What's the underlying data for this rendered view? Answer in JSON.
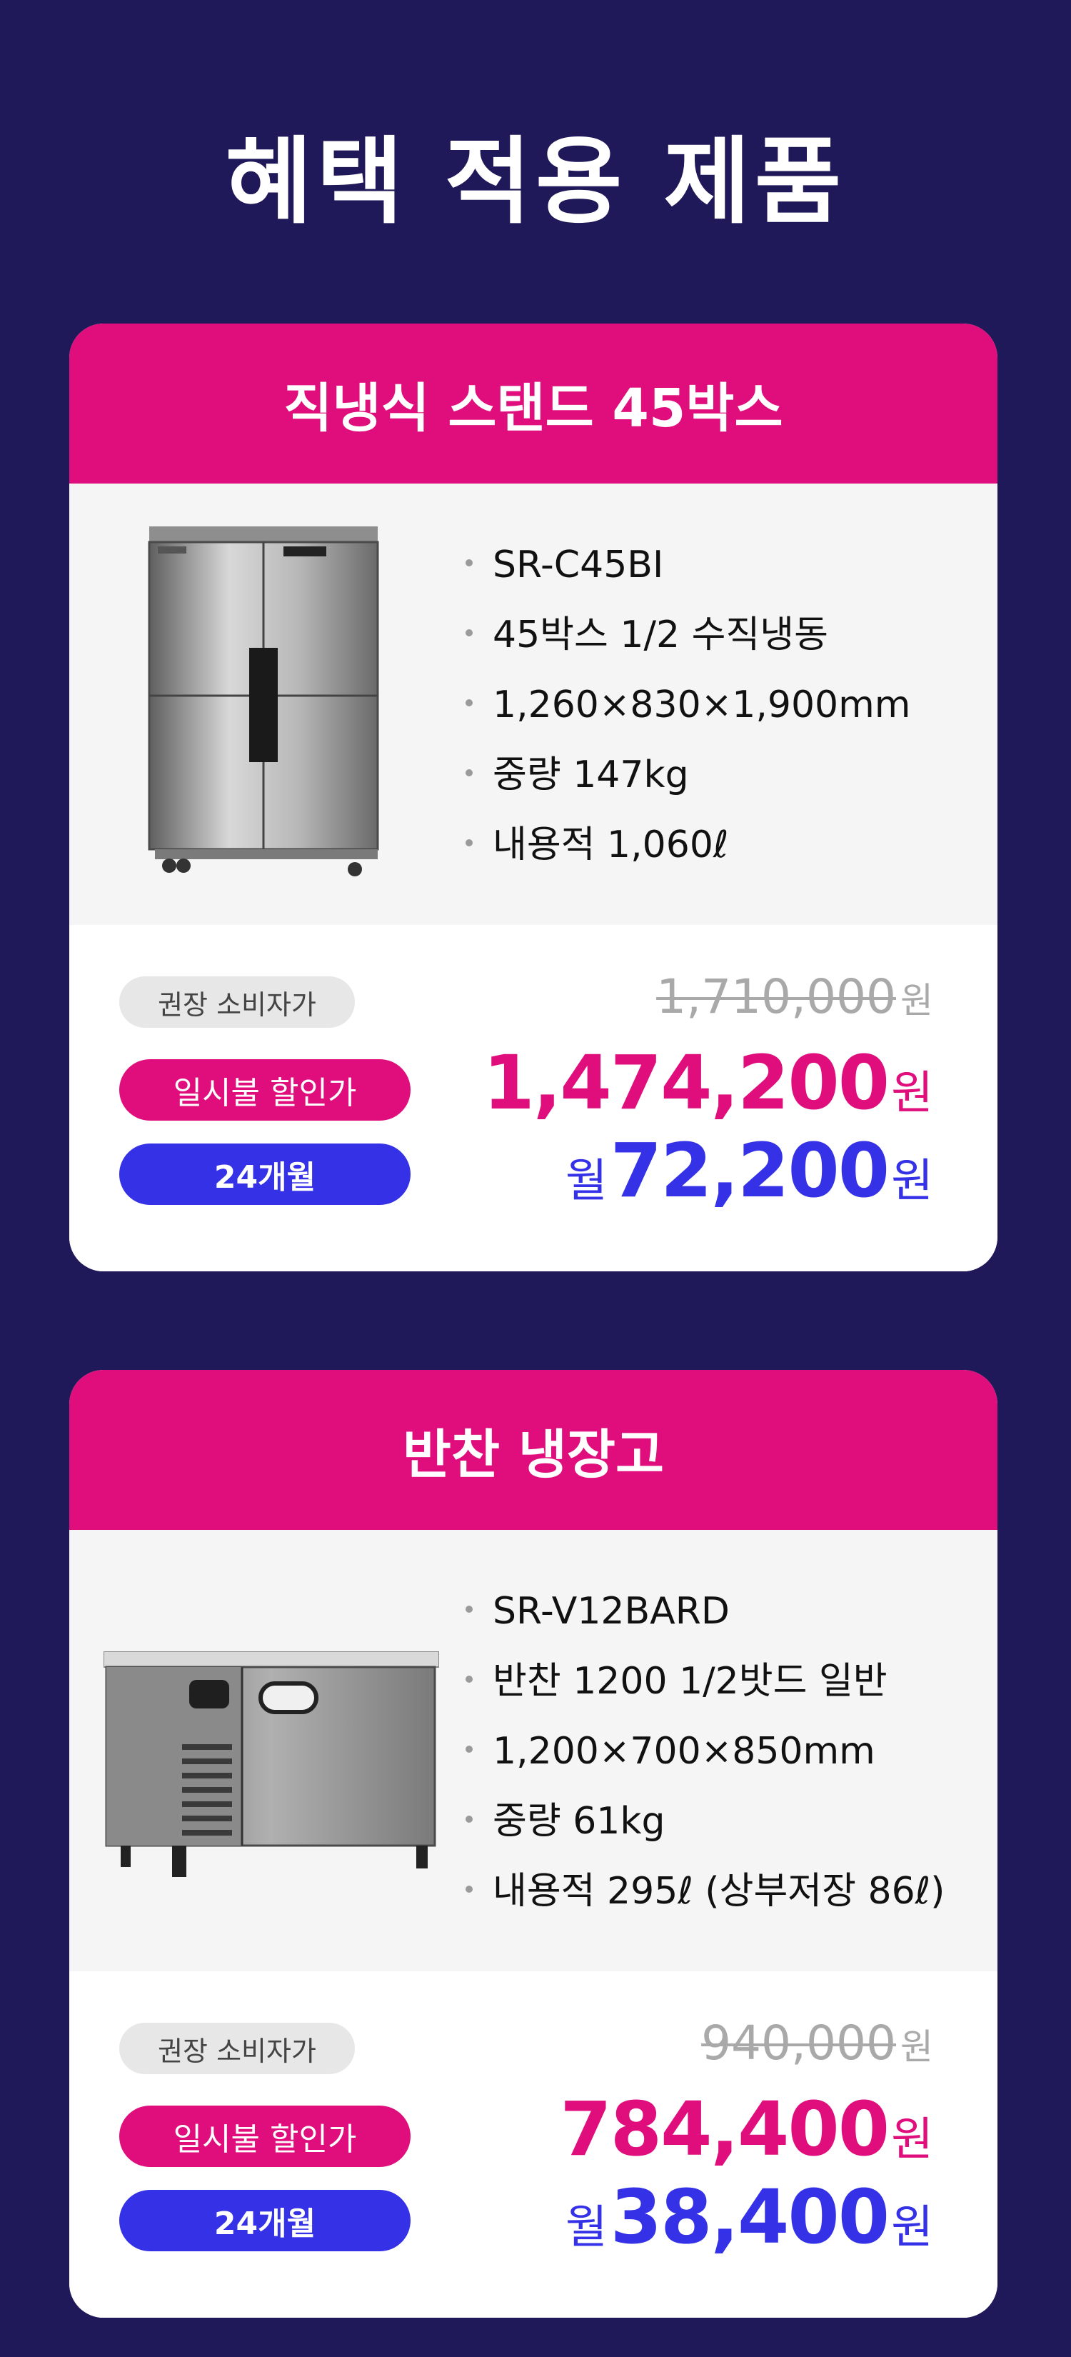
{
  "page": {
    "title": "혜택 적용 제품"
  },
  "products": [
    {
      "name": "직냉식 스탠드 45박스",
      "image": "stand-freezer-45box",
      "specs": [
        "SR-C45BI",
        "45박스 1/2 수직냉동",
        "1,260×830×1,900mm",
        "중량 147kg",
        "내용적 1,060ℓ"
      ],
      "pricing": {
        "msrp_label": "권장 소비자가",
        "msrp_value": "1,710,000",
        "lump_label": "일시불 할인가",
        "lump_value": "1,474,200",
        "monthly_label": "24개월",
        "monthly_prefix": "월",
        "monthly_value": "72,200",
        "currency": "원"
      }
    },
    {
      "name": "반찬 냉장고",
      "image": "side-dish-refrigerator",
      "specs": [
        "SR-V12BARD",
        "반찬 1200 1/2밧드 일반",
        "1,200×700×850mm",
        "중량 61kg",
        "내용적 295ℓ (상부저장 86ℓ)"
      ],
      "pricing": {
        "msrp_label": "권장 소비자가",
        "msrp_value": "940,000",
        "lump_label": "일시불 할인가",
        "lump_value": "784,400",
        "monthly_label": "24개월",
        "monthly_prefix": "월",
        "monthly_value": "38,400",
        "currency": "원"
      }
    }
  ],
  "colors": {
    "background": "#1f1859",
    "accent_pink": "#e00e7c",
    "accent_blue": "#3431e6"
  }
}
